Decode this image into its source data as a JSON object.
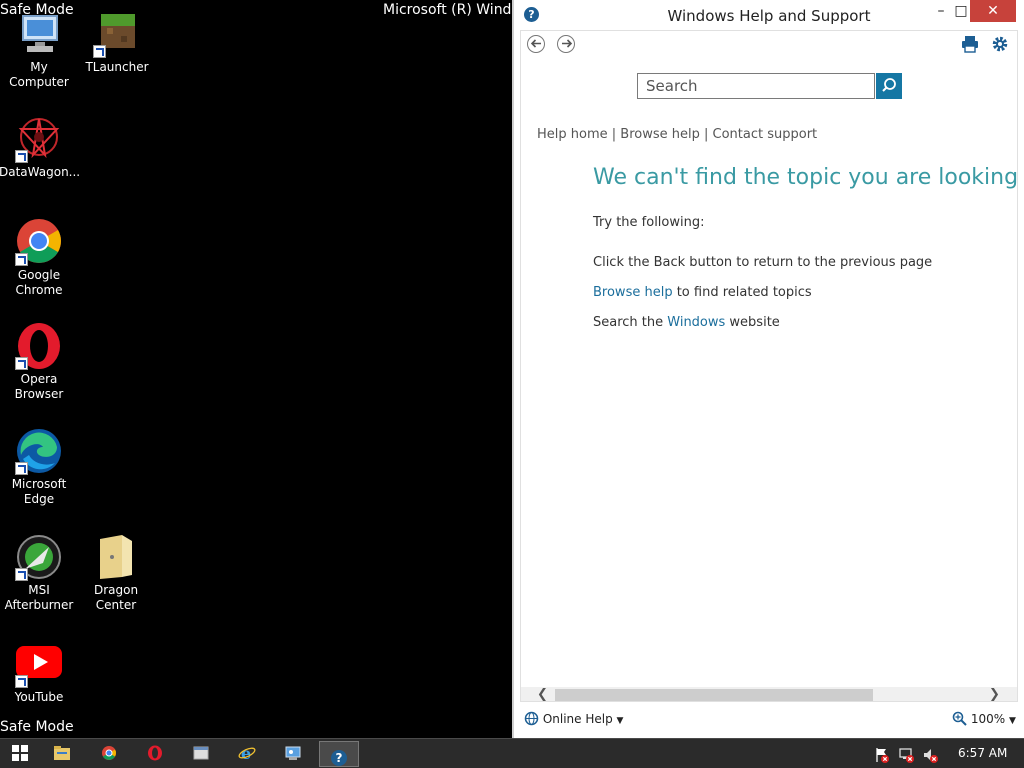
{
  "desktop": {
    "safe_mode_top": "Safe Mode",
    "safe_mode_bottom": "Safe Mode",
    "os_title": "Microsoft (R) Windows",
    "icons": [
      {
        "label": "My Computer"
      },
      {
        "label": "TLauncher"
      },
      {
        "label": "DataWagon..."
      },
      {
        "label": "Google Chrome"
      },
      {
        "label": "Opera Browser"
      },
      {
        "label": "Microsoft Edge"
      },
      {
        "label": "MSI Afterburner"
      },
      {
        "label": "Dragon Center"
      },
      {
        "label": "YouTube"
      }
    ]
  },
  "help_window": {
    "title": "Windows Help and Support",
    "controls": {
      "minimize": "–",
      "maximize": "□",
      "close": "✕"
    },
    "search": {
      "placeholder": "Search",
      "value": ""
    },
    "breadcrumbs": [
      "Help home",
      "Browse help",
      "Contact support"
    ],
    "breadcrumb_sep": " | ",
    "heading": "We can't find the topic you are looking for",
    "try_following": "Try the following:",
    "suggestion_back": "Click the Back button to return to the previous page",
    "suggestion_browse_link": "Browse help",
    "suggestion_browse_rest": " to find related topics",
    "suggestion_search_pre": "Search the ",
    "suggestion_search_link": "Windows",
    "suggestion_search_post": " website",
    "status": {
      "online_help": "Online Help",
      "zoom": "100%"
    },
    "colors": {
      "accent": "#3a9aa3",
      "link": "#1b6e9c",
      "search_button": "#1577a4",
      "close": "#c7423b"
    }
  },
  "taskbar": {
    "clock": "6:57 AM"
  }
}
